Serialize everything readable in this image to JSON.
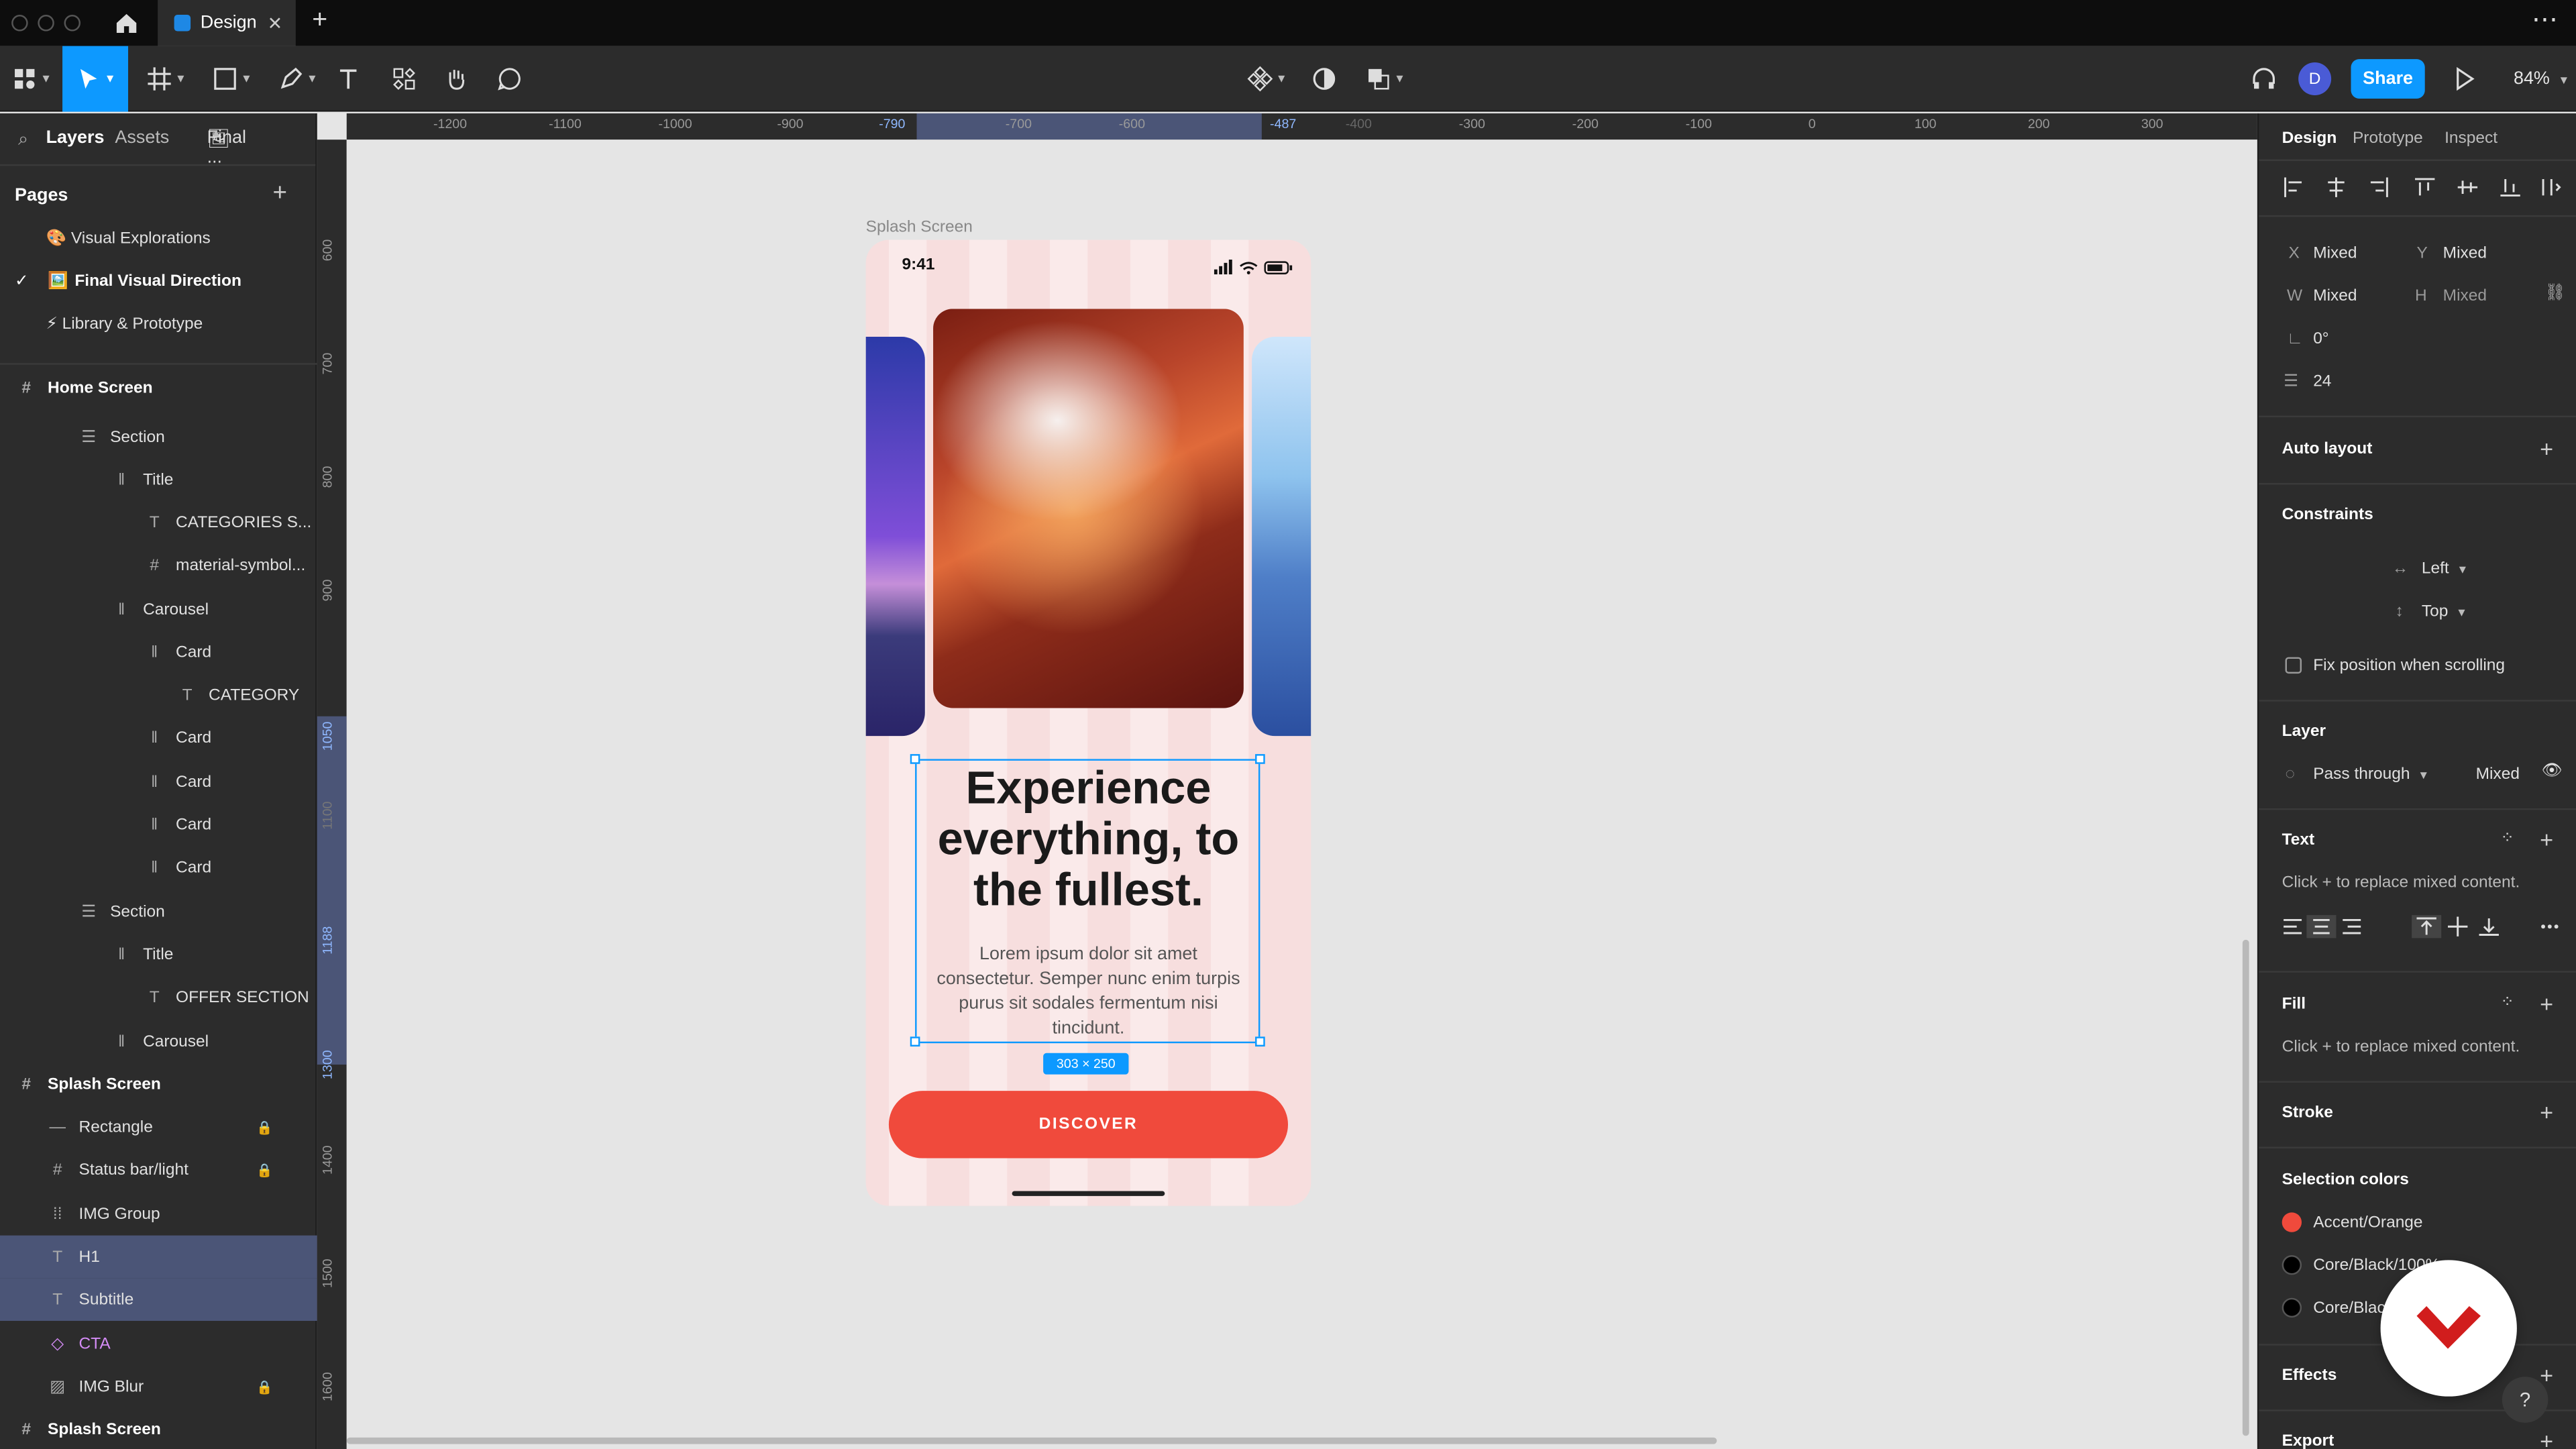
{
  "tabbar": {
    "tab_title": "Design",
    "new_tab": "+",
    "more": "⋯"
  },
  "toolbar": {
    "avatar_initial": "D",
    "share_label": "Share",
    "zoom": "84%"
  },
  "left_panel": {
    "tabs": {
      "layers": "Layers",
      "assets": "Assets",
      "file": "Final ..."
    },
    "pages_title": "Pages",
    "pages": [
      {
        "label": "🎨 Visual Explorations"
      },
      {
        "label": "Final Visual Direction",
        "emoji": "🖼️",
        "checked": "✓"
      },
      {
        "label": "⚡ Library & Prototype"
      }
    ],
    "layers": [
      "Home Screen",
      "Section",
      "Title",
      "CATEGORIES S...",
      "material-symbol...",
      "Carousel",
      "Card",
      "CATEGORY",
      "Card",
      "Card",
      "Card",
      "Card",
      "Section",
      "Title",
      "OFFER SECTION",
      "Carousel",
      "Splash Screen",
      "Rectangle",
      "Status bar/light",
      "IMG Group",
      "H1",
      "Subtitle",
      "CTA",
      "IMG Blur",
      "Splash Screen"
    ]
  },
  "rulers": {
    "h": [
      "-1200",
      "-1100",
      "-1000",
      "-900",
      "-790",
      "-700",
      "-600",
      "-487",
      "-400",
      "-300",
      "-200",
      "-100",
      "0",
      "100",
      "200",
      "300"
    ],
    "v": [
      "600",
      "700",
      "800",
      "900",
      "1050",
      "1100",
      "1188",
      "1300",
      "1400",
      "1500",
      "1600"
    ]
  },
  "canvas": {
    "frame_label": "Splash Screen",
    "time": "9:41",
    "h1": "Experience everything, to the fullest.",
    "subtitle": "Lorem ipsum dolor sit amet consectetur. Semper nunc enim turpis purus sit sodales fermentum nisi tincidunt.",
    "cta": "DISCOVER",
    "size_badge": "303 × 250"
  },
  "right_panel": {
    "tabs": {
      "design": "Design",
      "prototype": "Prototype",
      "inspect": "Inspect"
    },
    "x_label": "X",
    "x_value": "Mixed",
    "y_label": "Y",
    "y_value": "Mixed",
    "w_label": "W",
    "w_value": "Mixed",
    "h_label": "H",
    "h_value": "Mixed",
    "rotation": "0°",
    "spacing": "24",
    "auto_layout": "Auto layout",
    "constraints": "Constraints",
    "constraint_h": "Left",
    "constraint_v": "Top",
    "fix_position": "Fix position when scrolling",
    "layer": "Layer",
    "blend": "Pass through",
    "opacity": "Mixed",
    "text": "Text",
    "text_hint": "Click + to replace mixed content.",
    "fill": "Fill",
    "fill_hint": "Click + to replace mixed content.",
    "stroke": "Stroke",
    "selection_colors": "Selection colors",
    "colors": [
      {
        "name": "Accent/Orange",
        "hex": "#f04a3c"
      },
      {
        "name": "Core/Black/100%",
        "hex": "#000000"
      },
      {
        "name": "Core/Black/80%",
        "hex": "#000000"
      }
    ],
    "effects": "Effects",
    "export": "Export",
    "help": "?"
  }
}
